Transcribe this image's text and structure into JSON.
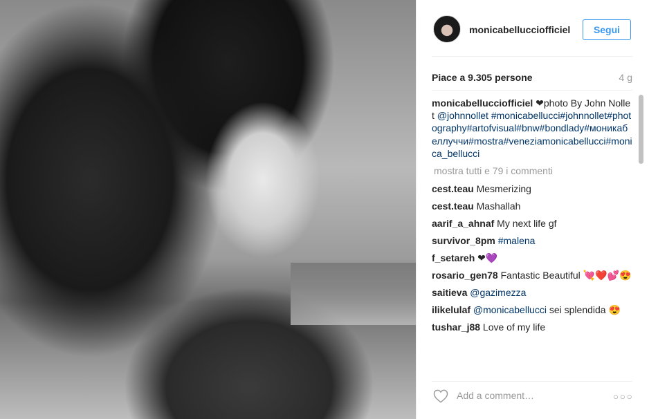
{
  "post": {
    "username": "monicabellucciofficiel",
    "follow_label": "Segui",
    "likes": "Piace a 9.305 persone",
    "age": "4 g",
    "caption": {
      "username": "monicabellucciofficiel",
      "text": " ❤photo By John Nollet ",
      "mention": "@johnnollet",
      "hashtags": " #monicabellucci#johnnollet#photography#artofvisual#bnw#bondlady#моникабеллуччи#mostra#veneziamonicabellucci#monica_bellucci"
    },
    "view_all_comments": "mostra tutti e 79 i commenti",
    "comments": [
      {
        "user": "cest.teau",
        "text": " Mesmerizing",
        "link": ""
      },
      {
        "user": "cest.teau",
        "text": " Mashallah",
        "link": ""
      },
      {
        "user": "aarif_a_ahnaf",
        "text": " My next life gf",
        "link": ""
      },
      {
        "user": "survivor_8pm",
        "text": " ",
        "link": "#malena"
      },
      {
        "user": "f_setareh",
        "text": " ❤💜",
        "link": ""
      },
      {
        "user": "rosario_gen78",
        "text": " Fantastic Beautiful 💘❤️💕😍",
        "link": ""
      },
      {
        "user": "saitieva",
        "text": " ",
        "link": "@gazimezza"
      },
      {
        "user": "ilikelulaf",
        "text": " sei splendida 😍",
        "link": "@monicabellucci"
      },
      {
        "user": "tushar_j88",
        "text": " Love of my life",
        "link": ""
      }
    ],
    "comment_placeholder": "Add a comment…",
    "more_options": "○○○"
  },
  "icons": {
    "heart": "heart-outline-icon",
    "more": "more-options-icon"
  },
  "colors": {
    "accent": "#3897f0",
    "link": "#003569",
    "muted": "#999999"
  }
}
